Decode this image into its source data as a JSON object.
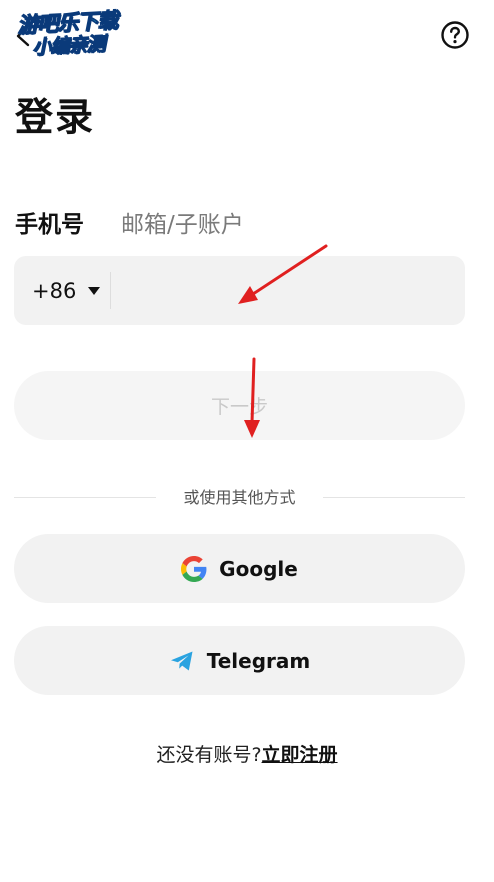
{
  "header": {
    "back_icon": "chevron-left-icon",
    "help_icon": "question-circle-icon",
    "watermark": {
      "line1": "游吧乐下载",
      "line2": "小编亲测"
    }
  },
  "page": {
    "title": "登录"
  },
  "tabs": [
    {
      "label": "手机号",
      "active": true
    },
    {
      "label": "邮箱/子账户",
      "active": false
    }
  ],
  "phone_field": {
    "country_code": "+86",
    "value": "",
    "placeholder": ""
  },
  "next_button": {
    "label": "下一步",
    "enabled": false
  },
  "alt_login": {
    "divider_label": "或使用其他方式",
    "google": {
      "label": "Google",
      "icon": "google-icon"
    },
    "telegram": {
      "label": "Telegram",
      "icon": "telegram-icon"
    }
  },
  "register": {
    "prompt": "还没有账号?",
    "link": "立即注册"
  },
  "colors": {
    "field_bg": "#f2f2f2",
    "annotation_arrow": "#e02020",
    "telegram_blue": "#2aa3e0"
  }
}
